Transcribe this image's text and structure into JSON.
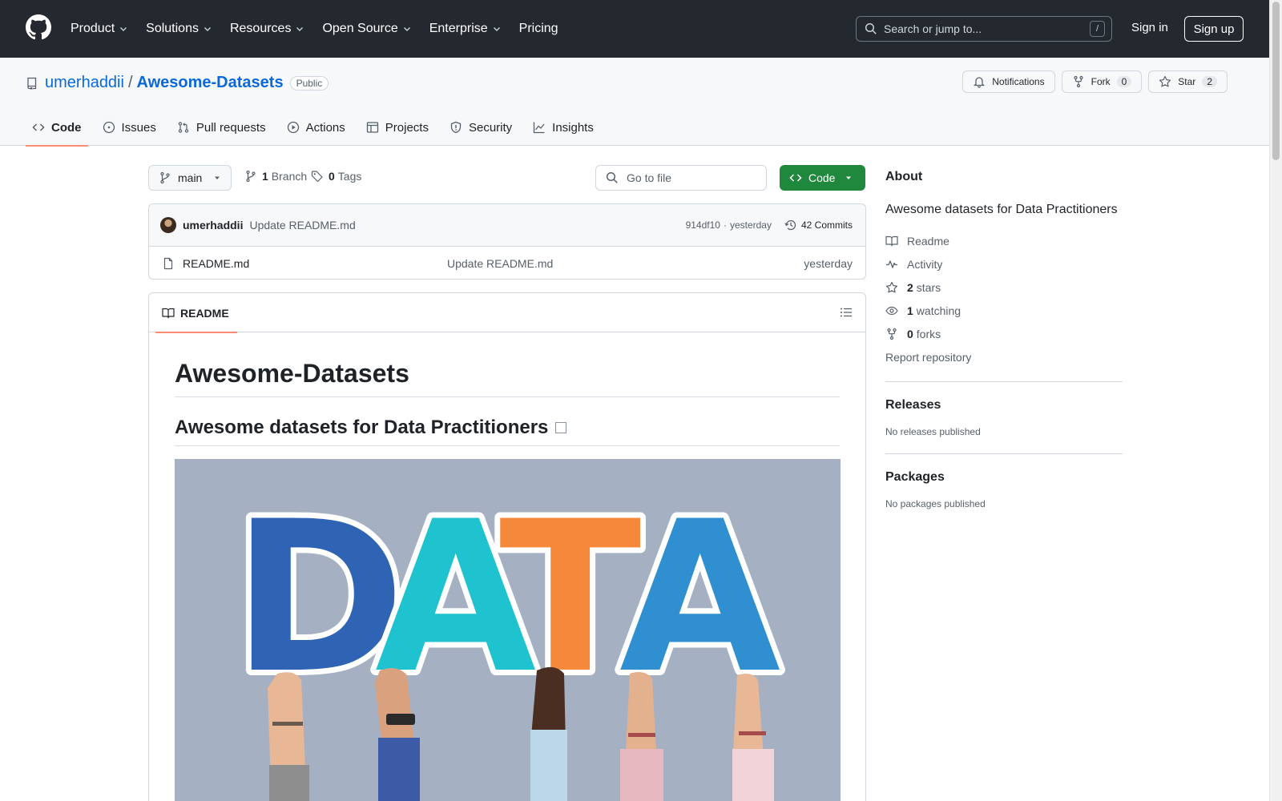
{
  "header": {
    "nav": [
      {
        "label": "Product",
        "dropdown": true
      },
      {
        "label": "Solutions",
        "dropdown": true
      },
      {
        "label": "Resources",
        "dropdown": true
      },
      {
        "label": "Open Source",
        "dropdown": true
      },
      {
        "label": "Enterprise",
        "dropdown": true
      },
      {
        "label": "Pricing",
        "dropdown": false
      }
    ],
    "search_placeholder": "Search or jump to...",
    "search_shortcut": "/",
    "sign_in": "Sign in",
    "sign_up": "Sign up"
  },
  "repo": {
    "owner": "umerhaddii",
    "separator": "/",
    "name": "Awesome-Datasets",
    "visibility": "Public",
    "notifications_label": "Notifications",
    "fork_label": "Fork",
    "fork_count": "0",
    "star_label": "Star",
    "star_count": "2",
    "tabs": [
      {
        "label": "Code",
        "icon": "code-icon",
        "active": true
      },
      {
        "label": "Issues",
        "icon": "issue-icon",
        "active": false
      },
      {
        "label": "Pull requests",
        "icon": "pull-request-icon",
        "active": false
      },
      {
        "label": "Actions",
        "icon": "play-icon",
        "active": false
      },
      {
        "label": "Projects",
        "icon": "table-icon",
        "active": false
      },
      {
        "label": "Security",
        "icon": "shield-icon",
        "active": false
      },
      {
        "label": "Insights",
        "icon": "graph-icon",
        "active": false
      }
    ]
  },
  "filenav": {
    "branch": "main",
    "branch_count": "1",
    "branch_label": "Branch",
    "tag_count": "0",
    "tag_label": "Tags",
    "goto_placeholder": "Go to file",
    "code_button": "Code"
  },
  "commit": {
    "author": "umerhaddii",
    "message": "Update README.md",
    "hash": "914df10",
    "dot": "·",
    "age": "yesterday",
    "commits_count": "42 Commits"
  },
  "files": [
    {
      "name": "README.md",
      "message": "Update README.md",
      "age": "yesterday"
    }
  ],
  "readme": {
    "tab_label": "README",
    "h1": "Awesome-Datasets",
    "h2": "Awesome datasets for Data Practitioners",
    "hero_letters": [
      "D",
      "A",
      "T",
      "A"
    ]
  },
  "sidebar": {
    "about_title": "About",
    "description": "Awesome datasets for Data Practitioners",
    "links": [
      {
        "icon": "book-icon",
        "count": "",
        "label": "Readme"
      },
      {
        "icon": "pulse-icon",
        "count": "",
        "label": "Activity"
      },
      {
        "icon": "star-icon",
        "count": "2",
        "label": "stars"
      },
      {
        "icon": "eye-icon",
        "count": "1",
        "label": "watching"
      },
      {
        "icon": "fork-icon",
        "count": "0",
        "label": "forks"
      }
    ],
    "report": "Report repository",
    "releases_title": "Releases",
    "releases_note": "No releases published",
    "packages_title": "Packages",
    "packages_note": "No packages published"
  },
  "colors": {
    "header_bg": "#24292f",
    "link": "#0969da",
    "code_button": "#1f883d",
    "tab_underline": "#fd8c73",
    "hero_bg": "#a5b1c3",
    "letter_d": "#2e64b3",
    "letter_a1": "#1fc2cf",
    "letter_t": "#f6883a",
    "letter_a2": "#2f8fd0"
  }
}
